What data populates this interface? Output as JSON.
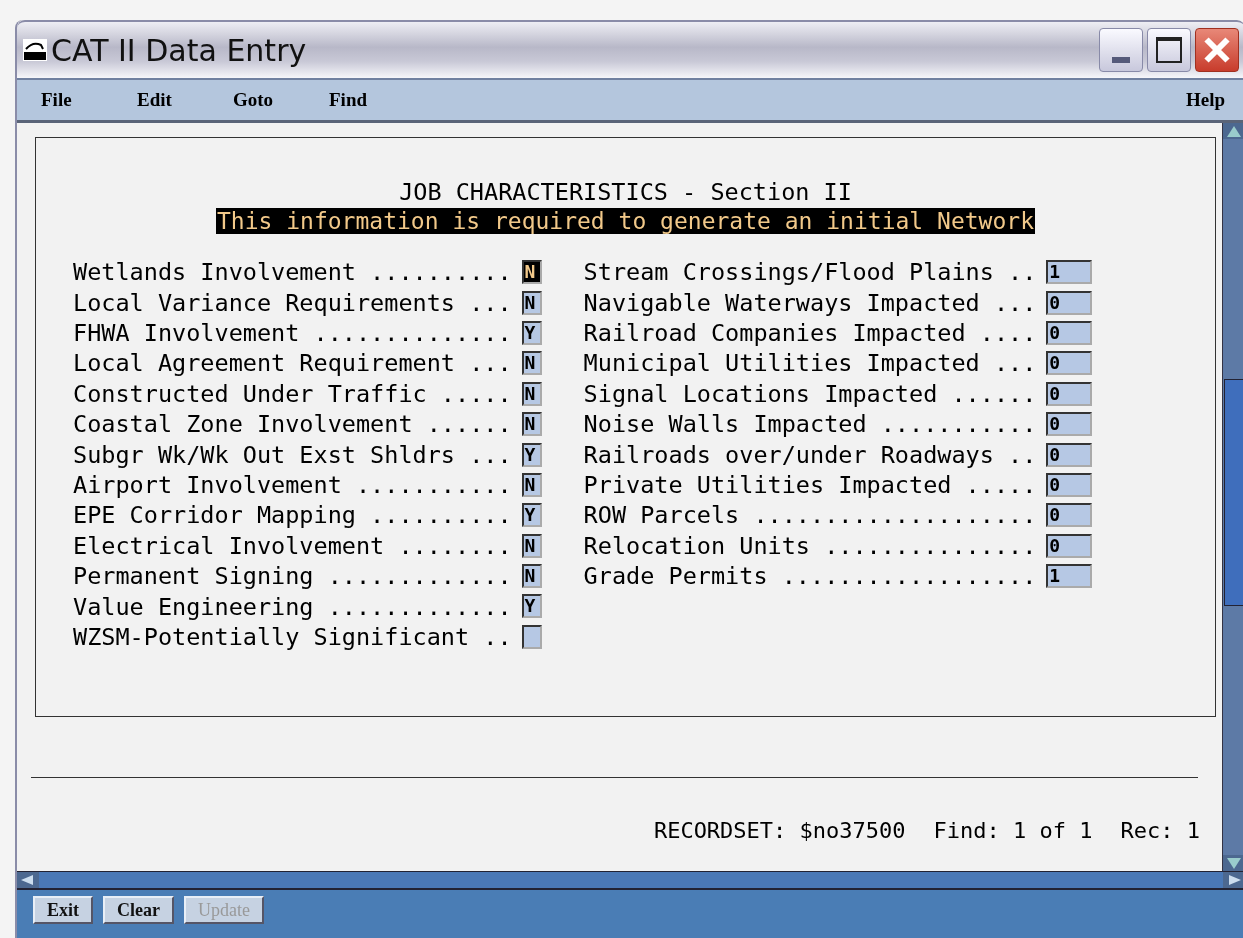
{
  "window": {
    "title": "CAT II Data Entry"
  },
  "menu": {
    "left": [
      "File",
      "Edit",
      "Goto",
      "Find"
    ],
    "right": [
      "Help"
    ]
  },
  "form": {
    "heading": "JOB CHARACTERISTICS - Section II",
    "notice": "This information is required to generate an initial Network",
    "left_fields": [
      {
        "label": "Wetlands Involvement ..........",
        "value": "N",
        "focused": true
      },
      {
        "label": "Local Variance Requirements ...",
        "value": "N",
        "focused": false
      },
      {
        "label": "FHWA Involvement ..............",
        "value": "Y",
        "focused": false
      },
      {
        "label": "Local Agreement Requirement ...",
        "value": "N",
        "focused": false
      },
      {
        "label": "Constructed Under Traffic .....",
        "value": "N",
        "focused": false
      },
      {
        "label": "Coastal Zone Involvement ......",
        "value": "N",
        "focused": false
      },
      {
        "label": "Subgr Wk/Wk Out Exst Shldrs ...",
        "value": "Y",
        "focused": false
      },
      {
        "label": "Airport Involvement ...........",
        "value": "N",
        "focused": false
      },
      {
        "label": "EPE Corridor Mapping ..........",
        "value": "Y",
        "focused": false
      },
      {
        "label": "Electrical Involvement ........",
        "value": "N",
        "focused": false
      },
      {
        "label": "Permanent Signing .............",
        "value": "N",
        "focused": false
      },
      {
        "label": "Value Engineering .............",
        "value": "Y",
        "focused": false
      },
      {
        "label": "WZSM-Potentially Significant ..",
        "focused": false
      }
    ],
    "right_fields": [
      {
        "label": "Stream Crossings/Flood Plains ..",
        "value": "1",
        "focused": false
      },
      {
        "label": "Navigable Waterways Impacted ...",
        "value": "0",
        "focused": false
      },
      {
        "label": "Railroad Companies Impacted ....",
        "value": "0",
        "focused": false
      },
      {
        "label": "Municipal Utilities Impacted ...",
        "value": "0",
        "focused": false
      },
      {
        "label": "Signal Locations Impacted ......",
        "value": "0",
        "focused": false
      },
      {
        "label": "Noise Walls Impacted ...........",
        "value": "0",
        "focused": false
      },
      {
        "label": "Railroads over/under Roadways ..",
        "value": "0",
        "focused": false
      },
      {
        "label": "Private Utilities Impacted .....",
        "value": "0",
        "focused": false
      },
      {
        "label": "ROW Parcels ....................",
        "value": "0",
        "focused": false
      },
      {
        "label": "Relocation Units ...............",
        "value": "0",
        "focused": false
      },
      {
        "label": "Grade Permits ..................",
        "value": "1",
        "focused": false
      }
    ]
  },
  "status": [
    "RECORDSET: $no37500",
    "Find: 1 of 1",
    "Rec: 1"
  ],
  "buttons": [
    {
      "label": "Exit",
      "disabled": false
    },
    {
      "label": "Clear",
      "disabled": false
    },
    {
      "label": "Update",
      "disabled": true
    }
  ]
}
